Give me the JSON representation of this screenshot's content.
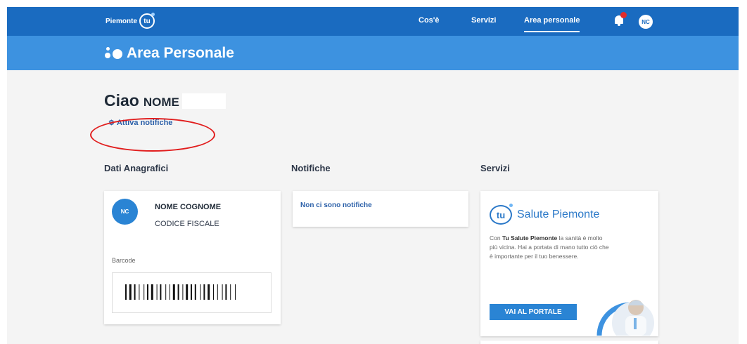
{
  "topbar": {
    "logo_text": "Piemonte",
    "logo_mark": "tu",
    "nav": [
      "Cos'è",
      "Servizi",
      "Area personale"
    ],
    "active_nav": "Area personale",
    "user_initials": "NC",
    "bell_icon": "bell-icon",
    "notification_badge_color": "#e22b2b",
    "bar_color": "#1a6bc0"
  },
  "subheader": {
    "title": "Area Personale",
    "color": "#3d92e0"
  },
  "greeting": {
    "hello": "Ciao",
    "name": "NOME"
  },
  "notif_link": {
    "icon": "gear-icon",
    "label": "Attiva notifiche"
  },
  "annotation": {
    "shape": "ellipse",
    "color": "#e11d1d"
  },
  "sections": {
    "anagrafica": "Dati Anagrafici",
    "notifiche": "Notifiche",
    "servizi": "Servizi"
  },
  "anagrafica_card": {
    "initials": "NC",
    "full_name": "NOME COGNOME",
    "fiscal_code": "CODICE FISCALE",
    "barcode_label": "Barcode"
  },
  "notifiche_card": {
    "empty_text": "Non ci sono notifiche"
  },
  "service_card": {
    "logo_mark": "tu",
    "name": "Salute Piemonte",
    "description_intro": "Con",
    "description_brand": "Tu Salute Piemonte",
    "description_rest": "la sanità è molto più vicina. Hai a portata di mano tutto ciò che è importante per il tuo benessere.",
    "button_label": "VAI AL PORTALE",
    "accent_color": "#2a84d4"
  }
}
